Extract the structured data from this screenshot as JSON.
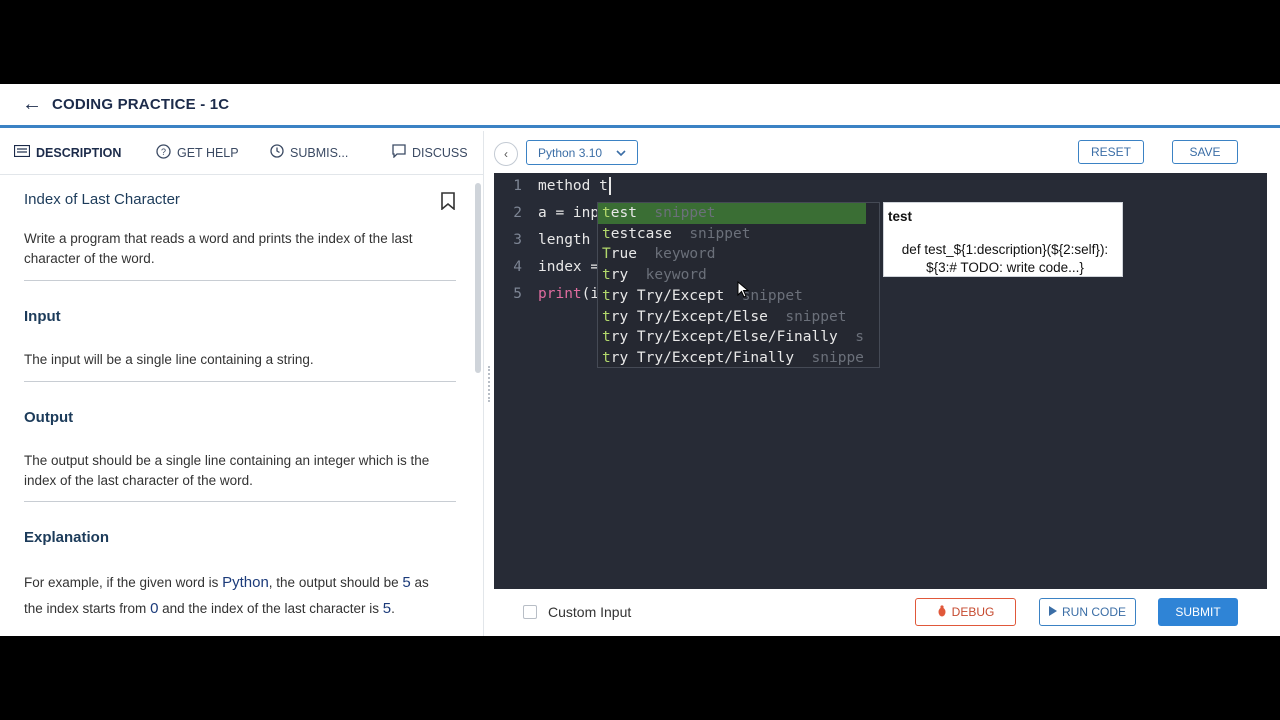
{
  "header": {
    "title": "CODING PRACTICE - 1C"
  },
  "tabs": [
    {
      "label": "DESCRIPTION",
      "icon": "description-icon"
    },
    {
      "label": "GET HELP",
      "icon": "help-icon"
    },
    {
      "label": "SUBMIS...",
      "icon": "clock-icon"
    },
    {
      "label": "DISCUSS",
      "icon": "chat-icon"
    }
  ],
  "problem": {
    "title": "Index of Last Character",
    "description": "Write a program that reads a word and prints the index of the last character of the word.",
    "input_heading": "Input",
    "input_text": "The input will be a single line containing a string.",
    "output_heading": "Output",
    "output_text": "The output should be a single line containing an integer which is the index of the last character of the word.",
    "explanation_heading": "Explanation",
    "explanation": {
      "p1": "For example, if the given word is ",
      "word": "Python",
      "p2": ", the output should be ",
      "out": "5",
      "p3": " as the index starts from ",
      "zero": "0",
      "p4": " and the index of the last character is ",
      "last": "5",
      "p5": "."
    }
  },
  "toolbar": {
    "language": "Python 3.10",
    "reset": "RESET",
    "save": "SAVE"
  },
  "editor": {
    "lines": [
      {
        "num": "1",
        "text": "method t"
      },
      {
        "num": "2",
        "text": "a = inp"
      },
      {
        "num": "3",
        "text": "length"
      },
      {
        "num": "4",
        "text": "index ="
      },
      {
        "num": "5",
        "text": "(i",
        "prefix": "print"
      }
    ],
    "suggestions": [
      {
        "match": "t",
        "rest": "est",
        "kind": "snippet"
      },
      {
        "match": "t",
        "rest": "estcase",
        "kind": "snippet"
      },
      {
        "match": "T",
        "rest": "rue",
        "kind": "keyword"
      },
      {
        "match": "t",
        "rest": "ry",
        "kind": "keyword"
      },
      {
        "match": "t",
        "rest": "ry Try/Except",
        "kind": "snippet"
      },
      {
        "match": "t",
        "rest": "ry Try/Except/Else",
        "kind": "snippet"
      },
      {
        "match": "t",
        "rest": "ry Try/Except/Else/Finally",
        "kind": "s"
      },
      {
        "match": "t",
        "rest": "ry Try/Except/Finally",
        "kind": "snippe"
      }
    ],
    "detail": {
      "title": "test",
      "body_line1": "def test_${1:description}(${2:self}):",
      "body_line2": "${3:# TODO: write code...}"
    }
  },
  "bottom": {
    "custom_input": "Custom Input",
    "debug": "DEBUG",
    "run_code": "RUN CODE",
    "submit": "SUBMIT"
  },
  "colors": {
    "accent": "#3b82c4",
    "editor_bg": "#272b36",
    "debug": "#e0583a",
    "submit": "#2f84d6"
  }
}
